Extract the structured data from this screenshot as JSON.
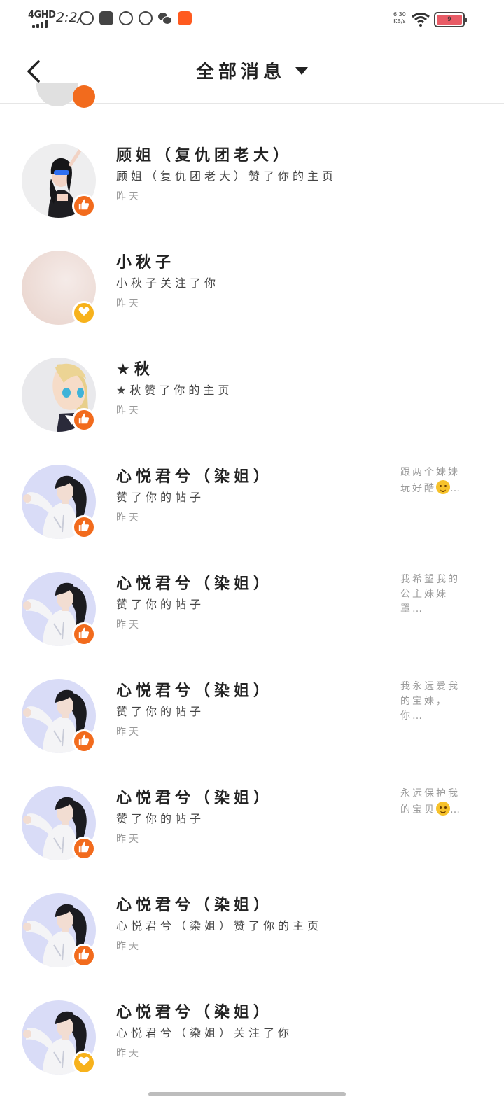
{
  "status_bar": {
    "network": "4GHD",
    "time": "2:2/",
    "speed_value": "6.30",
    "speed_unit": "KB/s",
    "battery": "9"
  },
  "header": {
    "back_icon": "chevron-left-icon",
    "title": "全部消息",
    "dropdown_icon": "caret-down-icon"
  },
  "messages": [
    {
      "name": "顾姐（复仇团老大）",
      "content": "顾姐（复仇团老大）赞了你的主页",
      "time": "昨天",
      "type": "like",
      "avatar": "avatar-girl-headphones",
      "preview": ""
    },
    {
      "name": "小秋子",
      "content": "小秋子关注了你",
      "time": "昨天",
      "type": "follow",
      "avatar": "avatar-blank-pink",
      "preview": ""
    },
    {
      "name": "★秋",
      "content": "★秋赞了你的主页",
      "time": "昨天",
      "type": "like",
      "avatar": "avatar-blonde-girl",
      "preview": ""
    },
    {
      "name": "心悦君兮（染姐）",
      "content": "赞了你的帖子",
      "time": "昨天",
      "type": "like",
      "avatar": "avatar-ponytail-girl",
      "preview": "跟两个妹妹玩好酷",
      "preview_emoji": "kiss-emoji"
    },
    {
      "name": "心悦君兮（染姐）",
      "content": "赞了你的帖子",
      "time": "昨天",
      "type": "like",
      "avatar": "avatar-ponytail-girl",
      "preview": "我希望我的公主妹妹罩…",
      "preview_emoji": ""
    },
    {
      "name": "心悦君兮（染姐）",
      "content": "赞了你的帖子",
      "time": "昨天",
      "type": "like",
      "avatar": "avatar-ponytail-girl",
      "preview": "我永远爱我的宝妹，你…",
      "preview_emoji": ""
    },
    {
      "name": "心悦君兮（染姐）",
      "content": "赞了你的帖子",
      "time": "昨天",
      "type": "like",
      "avatar": "avatar-ponytail-girl",
      "preview": "永远保护我的宝贝",
      "preview_emoji": "halo-emoji"
    },
    {
      "name": "心悦君兮（染姐）",
      "content": "心悦君兮（染姐）赞了你的主页",
      "time": "昨天",
      "type": "like",
      "avatar": "avatar-ponytail-girl",
      "preview": ""
    },
    {
      "name": "心悦君兮（染姐）",
      "content": "心悦君兮（染姐）关注了你",
      "time": "昨天",
      "type": "follow",
      "avatar": "avatar-ponytail-girl",
      "preview": ""
    }
  ],
  "colors": {
    "like_badge": "#f26b1d",
    "follow_badge": "#f7b21c",
    "ponytail_avatar_bg": "#d9dcf7"
  }
}
